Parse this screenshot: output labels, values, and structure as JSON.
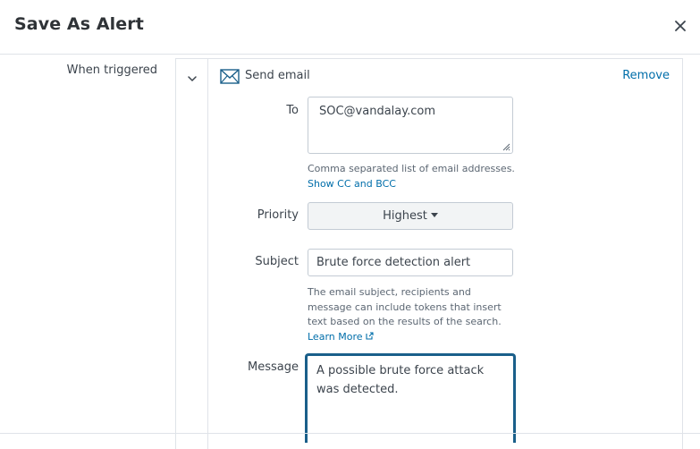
{
  "dialog": {
    "title": "Save As Alert"
  },
  "section": {
    "label": "When triggered"
  },
  "action": {
    "title": "Send email",
    "remove_label": "Remove",
    "to": {
      "label": "To",
      "value": "SOC@vandalay.com",
      "help": "Comma separated list of email addresses.",
      "link": "Show CC and BCC"
    },
    "priority": {
      "label": "Priority",
      "value": "Highest"
    },
    "subject": {
      "label": "Subject",
      "value": "Brute force detection alert",
      "help_lines": [
        "The email subject, recipients and",
        "message can include tokens that insert",
        "text based on the results of the search."
      ],
      "link": "Learn More"
    },
    "message": {
      "label": "Message",
      "value": "A possible brute force attack was detected."
    }
  },
  "colors": {
    "link": "#006eaa",
    "focus_border": "#1a5f8a",
    "border": "#c3cbd4"
  },
  "icons": {
    "close": "close-icon",
    "toggle": "chevron-down-icon",
    "action": "envelope-icon",
    "external": "external-link-icon"
  }
}
